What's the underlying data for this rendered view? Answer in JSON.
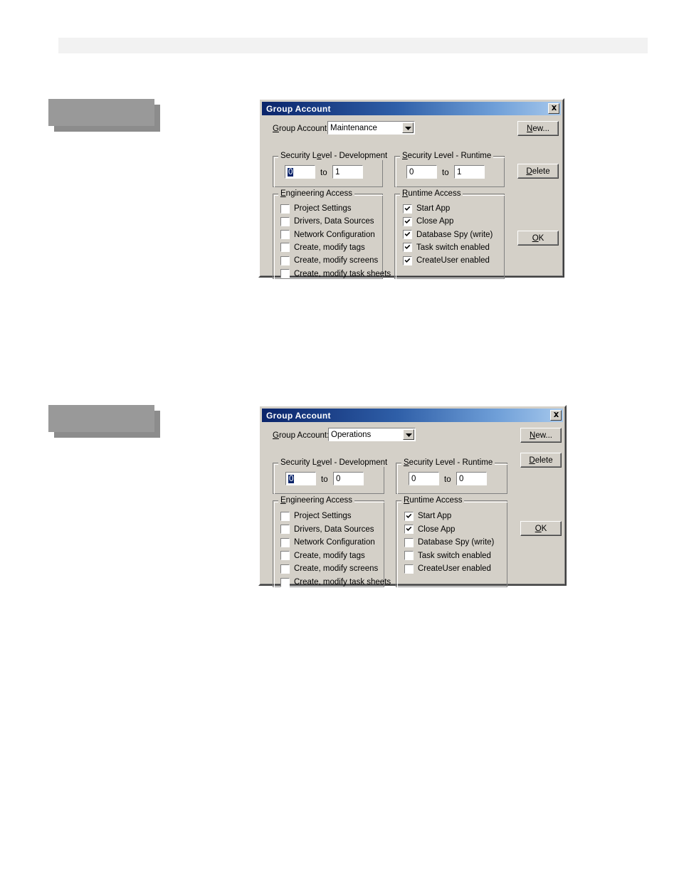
{
  "page": {
    "background": "#ffffff",
    "header_band_color": "#f2f2f2",
    "redact_color": "#999999",
    "redact_shadow_color": "#8c8c8c"
  },
  "colors": {
    "dialog_face": "#d4d0c8",
    "titlebar_start": "#0a246a",
    "titlebar_end": "#a6c8ec",
    "selection": "#0a246a",
    "field_bg": "#ffffff"
  },
  "common": {
    "title": "Group Account",
    "close_icon": "close-icon",
    "group_account_label_pre": "G",
    "group_account_label_post": "roup Account:",
    "combo_arrow_icon": "chevron-down-icon",
    "dev_group_pre": "Security L",
    "dev_group_mid": "e",
    "dev_group_post": "vel - Development",
    "rt_group_pre": "",
    "rt_group_mid": "S",
    "rt_group_post": "ecurity Level - Runtime",
    "to_label": "to",
    "eng_group_pre": "",
    "eng_group_mid": "E",
    "eng_group_post": "ngineering Access",
    "rta_group_pre": "",
    "rta_group_mid": "R",
    "rta_group_post": "untime Access",
    "buttons": {
      "new_pre": "",
      "new_mid": "N",
      "new_post": "ew...",
      "delete_pre": "",
      "delete_mid": "D",
      "delete_post": "elete",
      "ok_pre": "",
      "ok_mid": "O",
      "ok_post": "K"
    },
    "engineering_access_labels": [
      "Project Settings",
      "Drivers, Data Sources",
      "Network Configuration",
      "Create, modify tags",
      "Create, modify screens",
      "Create, modify task sheets"
    ],
    "runtime_access_labels": [
      "Start App",
      "Close App",
      "Database Spy (write)",
      "Task switch enabled",
      "CreateUser enabled"
    ]
  },
  "dialogs": [
    {
      "id": "maintenance",
      "group_account_value": "Maintenance",
      "security_dev_from": "0",
      "security_dev_to": "1",
      "security_rt_from": "0",
      "security_rt_to": "1",
      "dev_from_selected": true,
      "engineering_access_checked": [
        false,
        false,
        false,
        false,
        false,
        false
      ],
      "runtime_access_checked": [
        true,
        true,
        true,
        true,
        true
      ]
    },
    {
      "id": "operations",
      "group_account_value": "Operations",
      "security_dev_from": "0",
      "security_dev_to": "0",
      "security_rt_from": "0",
      "security_rt_to": "0",
      "dev_from_selected": true,
      "engineering_access_checked": [
        false,
        false,
        false,
        false,
        false,
        false
      ],
      "runtime_access_checked": [
        true,
        true,
        false,
        false,
        false
      ]
    }
  ]
}
